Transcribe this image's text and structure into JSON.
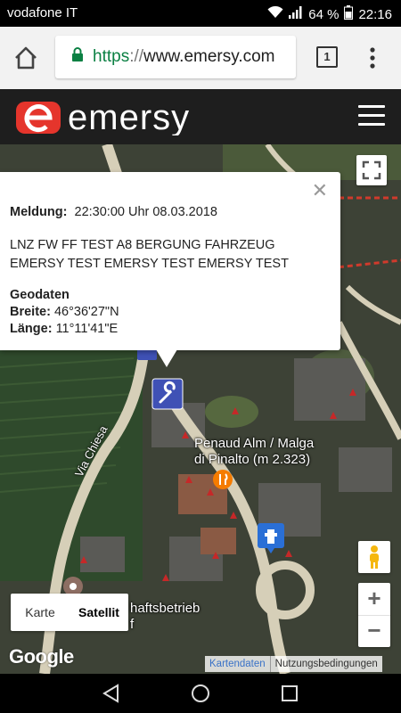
{
  "status_bar": {
    "carrier": "vodafone IT",
    "battery": "64 %",
    "time": "22:16"
  },
  "browser": {
    "url_scheme": "https",
    "url_sep": "://",
    "url_host": "www.emersy.com",
    "tab_count": "1"
  },
  "site": {
    "logo_text": "emersy",
    "accent_color": "#e5352c"
  },
  "info_window": {
    "label_meldung": "Meldung:",
    "meldung_value": "22:30:00 Uhr 08.03.2018",
    "message_line1": "LNZ FW FF TEST A8 BERGUNG FAHRZEUG",
    "message_line2": "EMERSY TEST EMERSY TEST EMERSY TEST",
    "geo_title": "Geodaten",
    "label_breite": "Breite:",
    "breite_value": "46°36'27\"N",
    "label_laenge": "Länge:",
    "laenge_value": "11°11'41\"E"
  },
  "map": {
    "poi_line1": "Penaud Alm / Malga",
    "poi_line2": "di Pinalto (m 2.323)",
    "street_chiesa": "Via Chiesa",
    "partial_label_1": "haftsbetrieb",
    "partial_label_2": "f",
    "maptype_map": "Karte",
    "maptype_satellite": "Satellit",
    "google_logo": "Google",
    "attribution_data": "Kartendaten",
    "attribution_terms": "Nutzungsbedingungen"
  }
}
